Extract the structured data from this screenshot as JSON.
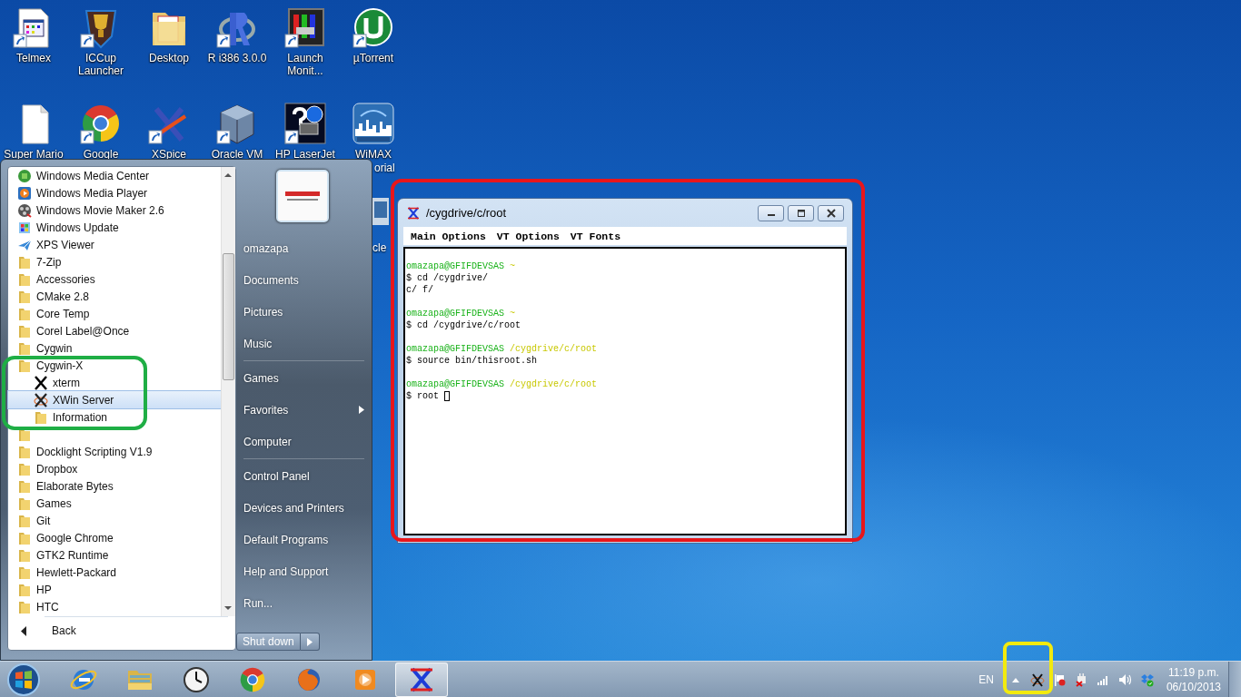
{
  "desktop_icons": [
    {
      "kind": "document-app",
      "lines": [
        "Telmex"
      ],
      "shortcut": true
    },
    {
      "kind": "trophy",
      "lines": [
        "ICCup",
        "Launcher"
      ],
      "shortcut": true
    },
    {
      "kind": "folder",
      "lines": [
        "Desktop"
      ],
      "shortcut": false
    },
    {
      "kind": "ring-logo",
      "lines": [
        "R i386 3.0.0"
      ],
      "shortcut": true
    },
    {
      "kind": "chart-app",
      "lines": [
        "Launch",
        "Monit..."
      ],
      "shortcut": true
    },
    {
      "kind": "circle-logo",
      "lines": [
        "µTorrent"
      ],
      "shortcut": true
    },
    {
      "kind": "blank-page",
      "lines": [
        "Super Mario"
      ],
      "shortcut": false
    },
    {
      "kind": "browser",
      "lines": [
        "Google"
      ],
      "shortcut": true
    },
    {
      "kind": "x-logo",
      "lines": [
        "XSpice"
      ],
      "shortcut": true
    },
    {
      "kind": "cube",
      "lines": [
        "Oracle VM"
      ],
      "shortcut": true
    },
    {
      "kind": "help-printer",
      "lines": [
        "HP LaserJet"
      ],
      "shortcut": true
    },
    {
      "kind": "skyline",
      "lines": [
        "WiMAX"
      ],
      "shortcut": false
    }
  ],
  "desktop_fragments": [
    {
      "text": "orial"
    },
    {
      "text": "cle"
    }
  ],
  "start_menu": {
    "programs": [
      {
        "kind": "media-center",
        "label": "Windows Media Center",
        "selected": false
      },
      {
        "kind": "media-player",
        "label": "Windows Media Player",
        "selected": false
      },
      {
        "kind": "movie-maker",
        "label": "Windows Movie Maker 2.6",
        "selected": false
      },
      {
        "kind": "update",
        "label": "Windows Update",
        "selected": false
      },
      {
        "kind": "xps",
        "label": "XPS Viewer",
        "selected": false
      },
      {
        "kind": "folder",
        "label": "7-Zip",
        "selected": false
      },
      {
        "kind": "folder",
        "label": "Accessories",
        "selected": false
      },
      {
        "kind": "folder",
        "label": "CMake 2.8",
        "selected": false
      },
      {
        "kind": "folder",
        "label": "Core Temp",
        "selected": false
      },
      {
        "kind": "folder",
        "label": "Corel Label@Once",
        "selected": false
      },
      {
        "kind": "folder",
        "label": "Cygwin",
        "selected": false
      },
      {
        "kind": "folder",
        "label": "Cygwin-X",
        "selected": false,
        "children": [
          {
            "kind": "x",
            "label": "xterm",
            "selected": false
          },
          {
            "kind": "x-server",
            "label": "XWin Server",
            "selected": true
          },
          {
            "kind": "folder",
            "label": "Information",
            "selected": false
          }
        ]
      },
      {
        "kind": "folder",
        "selected": false
      },
      {
        "kind": "folder",
        "label": "Docklight Scripting V1.9",
        "selected": false
      },
      {
        "kind": "folder",
        "label": "Dropbox",
        "selected": false
      },
      {
        "kind": "folder",
        "label": "Elaborate Bytes",
        "selected": false
      },
      {
        "kind": "folder",
        "label": "Games",
        "selected": false
      },
      {
        "kind": "folder",
        "label": "Git",
        "selected": false
      },
      {
        "kind": "folder",
        "label": "Google Chrome",
        "selected": false
      },
      {
        "kind": "folder",
        "label": "GTK2 Runtime",
        "selected": false
      },
      {
        "kind": "folder",
        "label": "Hewlett-Packard",
        "selected": false
      },
      {
        "kind": "folder",
        "label": "HP",
        "selected": false
      },
      {
        "kind": "folder",
        "label": "HTC",
        "selected": false
      }
    ],
    "back": "Back",
    "places": [
      [
        {
          "label": "omazapa"
        },
        {
          "label": "Documents"
        },
        {
          "label": "Pictures"
        },
        {
          "label": "Music"
        }
      ],
      [
        {
          "label": "Games"
        },
        {
          "label": "Favorites",
          "submenu": true
        },
        {
          "label": "Computer"
        }
      ],
      [
        {
          "label": "Control Panel"
        },
        {
          "label": "Devices and Printers"
        },
        {
          "label": "Default Programs"
        },
        {
          "label": "Help and Support"
        },
        {
          "label": "Run..."
        }
      ]
    ],
    "shutdown_button": "Shut down"
  },
  "xterm": {
    "title": "/cygdrive/c/root",
    "menus": [
      "Main Options",
      "VT Options",
      "VT Fonts"
    ],
    "lines": [
      {
        "kind": "prompt",
        "user": "omazapa@GFIFDEVSAS",
        "path": "~"
      },
      {
        "kind": "text",
        "text": "$ cd /cygdrive/"
      },
      {
        "kind": "text",
        "text": "c/ f/"
      },
      {
        "kind": "blank"
      },
      {
        "kind": "prompt",
        "user": "omazapa@GFIFDEVSAS",
        "path": "~"
      },
      {
        "kind": "text",
        "text": "$ cd /cygdrive/c/root"
      },
      {
        "kind": "blank"
      },
      {
        "kind": "prompt",
        "user": "omazapa@GFIFDEVSAS",
        "path": "/cygdrive/c/root"
      },
      {
        "kind": "text",
        "text": "$ source bin/thisroot.sh"
      },
      {
        "kind": "blank"
      },
      {
        "kind": "prompt",
        "user": "omazapa@GFIFDEVSAS",
        "path": "/cygdrive/c/root"
      },
      {
        "kind": "text",
        "text": "$ root",
        "cursor": true
      }
    ]
  },
  "taskbar": {
    "pinned": [
      {
        "kind": "ie",
        "active": false
      },
      {
        "kind": "explorer",
        "active": false
      },
      {
        "kind": "clock",
        "active": false
      },
      {
        "kind": "browser",
        "active": false
      },
      {
        "kind": "firefox",
        "active": false
      },
      {
        "kind": "media-player",
        "active": false
      },
      {
        "kind": "x-app",
        "active": true
      }
    ],
    "language": "EN",
    "tray_icons": [
      {
        "kind": "show-hidden"
      },
      {
        "kind": "x-server"
      },
      {
        "kind": "flag"
      },
      {
        "kind": "power"
      },
      {
        "kind": "signal"
      },
      {
        "kind": "volume"
      },
      {
        "kind": "dropbox"
      }
    ],
    "time": "11:19 p.m.",
    "date": "06/10/2013"
  },
  "annotations": [
    {
      "color": "#e8161b"
    },
    {
      "color": "#1fae45"
    },
    {
      "color": "#f2ea0f"
    }
  ]
}
